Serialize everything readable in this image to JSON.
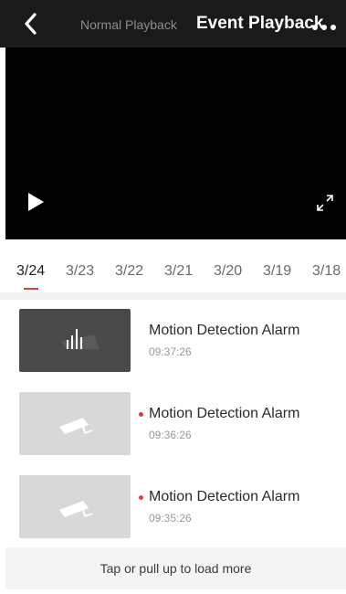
{
  "header": {
    "back_icon": "chevron-left-icon",
    "tab_normal": "Normal Playback",
    "tab_event": "Event Playback",
    "more_icon": "more-horizontal-icon"
  },
  "player": {
    "play_icon": "play-icon",
    "fullscreen_icon": "fullscreen-icon"
  },
  "dates": {
    "items": [
      "3/24",
      "3/23",
      "3/22",
      "3/21",
      "3/20",
      "3/19",
      "3/18"
    ],
    "selected": "3/24"
  },
  "events": [
    {
      "title": "Motion Detection Alarm",
      "time": "09:37:26",
      "unread": false,
      "thumb": "audio-bars-icon"
    },
    {
      "title": "Motion Detection Alarm",
      "time": "09:36:26",
      "unread": true,
      "thumb": "camera-icon"
    },
    {
      "title": "Motion Detection Alarm",
      "time": "09:35:26",
      "unread": true,
      "thumb": "camera-icon"
    }
  ],
  "load_more": "Tap or pull up to load more",
  "colors": {
    "accent": "#e03e3e",
    "header_bg": "#1a1a1a",
    "video_bg": "#000000"
  }
}
